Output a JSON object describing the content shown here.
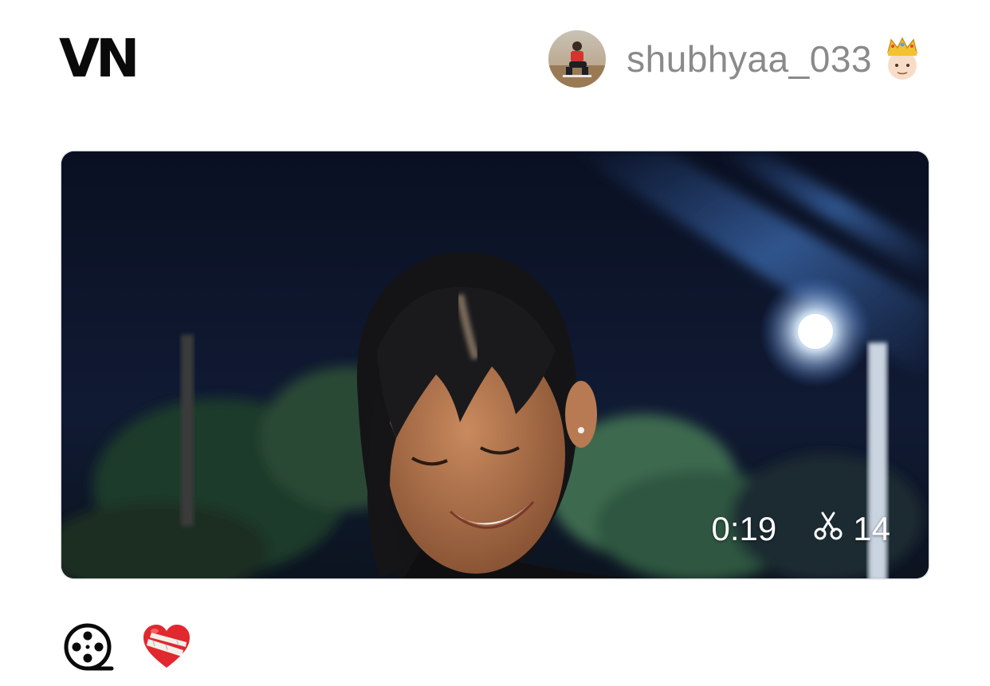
{
  "app": {
    "logo_text": "VN"
  },
  "user": {
    "username": "shubhyaa_033",
    "badge_icon": "crown-face-emoji",
    "avatar_icon": "profile-photo"
  },
  "video": {
    "duration": "0:19",
    "cut_count": "14",
    "cut_icon": "scissors-icon"
  },
  "actions": {
    "film_reel_icon": "film-reel-icon",
    "mending_heart_icon": "mending-heart-icon"
  },
  "colors": {
    "username": "#8a8a8a",
    "logo": "#0a0a0a",
    "overlay_text": "#ffffff"
  }
}
